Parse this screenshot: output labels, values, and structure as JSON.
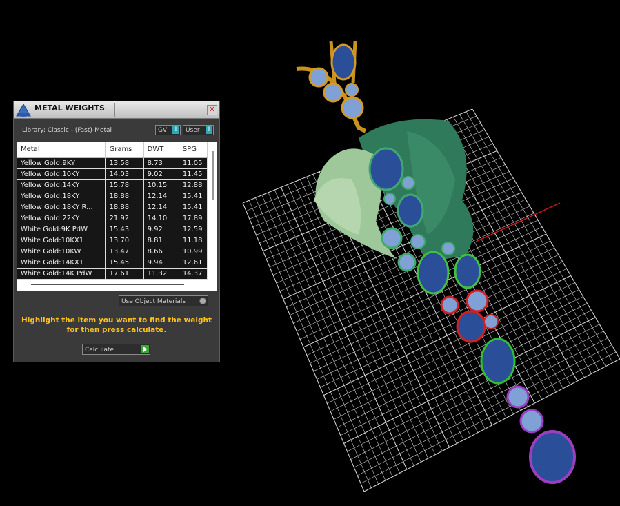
{
  "panel": {
    "title": "METAL WEIGHTS",
    "close": "✕",
    "library": "Library: Classic - (Fast)-Metal",
    "toggle_gv": "GV",
    "toggle_user": "User",
    "toggle_mark": "I",
    "columns": [
      "Metal",
      "Grams",
      "DWT",
      "SPG"
    ],
    "rows": [
      [
        "Yellow Gold:9KY",
        "13.58",
        "8.73",
        "11.05"
      ],
      [
        "Yellow Gold:10KY",
        "14.03",
        "9.02",
        "11.45"
      ],
      [
        "Yellow Gold:14KY",
        "15.78",
        "10.15",
        "12.88"
      ],
      [
        "Yellow Gold:18KY",
        "18.88",
        "12.14",
        "15.41"
      ],
      [
        "Yellow Gold:18KY R...",
        "18.88",
        "12.14",
        "15.41"
      ],
      [
        "Yellow Gold:22KY",
        "21.92",
        "14.10",
        "17.89"
      ],
      [
        "White Gold:9K PdW",
        "15.43",
        "9.92",
        "12.59"
      ],
      [
        "White Gold:10KX1",
        "13.70",
        "8.81",
        "11.18"
      ],
      [
        "White Gold:10KW",
        "13.47",
        "8.66",
        "10.99"
      ],
      [
        "White Gold:14KX1",
        "15.45",
        "9.94",
        "12.61"
      ],
      [
        "White Gold:14K PdW",
        "17.61",
        "11.32",
        "14.37"
      ]
    ],
    "materials_dropdown": "Use Object Materials",
    "instruction": "Highlight the item you want to find the weight for then press calculate.",
    "calculate": "Calculate"
  }
}
